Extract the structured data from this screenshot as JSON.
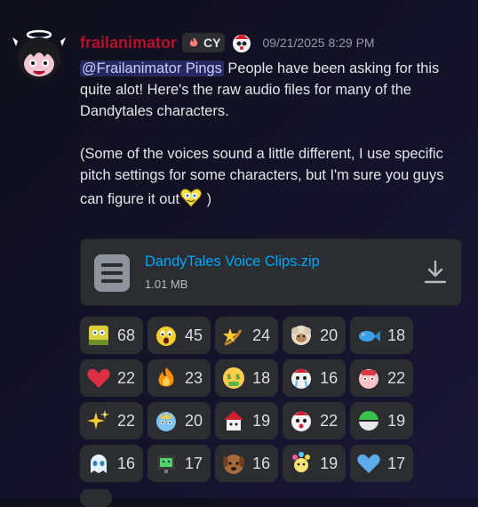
{
  "message": {
    "username": "frailanimator",
    "clan_tag": "CY",
    "timestamp": "09/21/2025 8:29 PM",
    "mention": "@Frailanimator Pings",
    "text_part1": " People have been asking for this quite alot! Here's the raw audio files for many of the Dandytales characters.",
    "text_part2": "(Some of the voices sound a little different, I use specific pitch settings for some characters, but I'm sure you guys can figure it out",
    "text_part2_end": " )"
  },
  "attachment": {
    "file_name": "DandyTales Voice Clips.zip",
    "file_size": "1.01 MB"
  },
  "reactions": [
    {
      "icon": "sponge-emoji",
      "count": "68"
    },
    {
      "icon": "shocked-face-emoji",
      "count": "45"
    },
    {
      "icon": "shooting-star-emoji",
      "count": "24"
    },
    {
      "icon": "sheep-emoji",
      "count": "20"
    },
    {
      "icon": "fish-emoji",
      "count": "18"
    },
    {
      "icon": "red-heart-emoji",
      "count": "22"
    },
    {
      "icon": "fire-emoji",
      "count": "23"
    },
    {
      "icon": "money-mouth-emoji",
      "count": "18"
    },
    {
      "icon": "crying-character-emoji",
      "count": "16"
    },
    {
      "icon": "pink-character-emoji",
      "count": "22"
    },
    {
      "icon": "sparkles-emoji",
      "count": "22"
    },
    {
      "icon": "blue-character-emoji",
      "count": "20"
    },
    {
      "icon": "house-character-emoji",
      "count": "19"
    },
    {
      "icon": "clown-character-emoji",
      "count": "22"
    },
    {
      "icon": "green-ball-emoji",
      "count": "19"
    },
    {
      "icon": "ghost-character-emoji",
      "count": "16"
    },
    {
      "icon": "robot-character-emoji",
      "count": "17"
    },
    {
      "icon": "dog-character-emoji",
      "count": "16"
    },
    {
      "icon": "flower-character-emoji",
      "count": "19"
    },
    {
      "icon": "blue-heart-emoji",
      "count": "17"
    }
  ],
  "colors": {
    "username": "#b3122a",
    "link": "#00a8fc",
    "reaction_bg": "#2b2d31",
    "mention_bg": "#3b3f8f"
  }
}
